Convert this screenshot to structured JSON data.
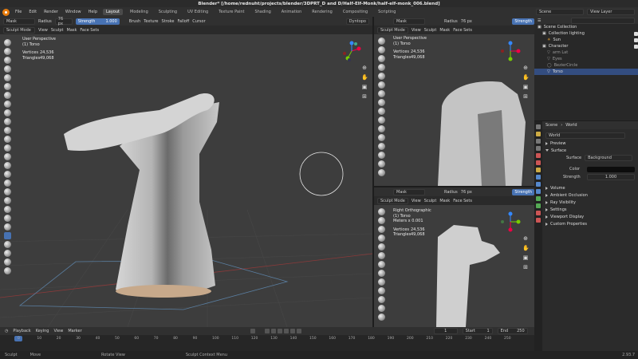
{
  "title": "Blender* [/home/rednuht/projects/blender/3DPRT_D and D/Half-Elf-Monk/half-elf-monk_006.blend]",
  "menu": [
    "File",
    "Edit",
    "Render",
    "Window",
    "Help"
  ],
  "workspaces": [
    "Layout",
    "Modeling",
    "Sculpting",
    "UV Editing",
    "Texture Paint",
    "Shading",
    "Animation",
    "Rendering",
    "Compositing",
    "Scripting"
  ],
  "active_workspace": "Layout",
  "scene_label": "Scene",
  "view_layer_label": "View Layer",
  "tool_header": {
    "brush": "Mask",
    "radius_label": "Radius",
    "radius_value": "76 px",
    "strength_label": "Strength",
    "strength_value": "1.000",
    "menus": [
      "Brush",
      "Texture",
      "Stroke",
      "Falloff",
      "Cursor"
    ],
    "dyntopo": "Dyntopo"
  },
  "mode_header": {
    "mode": "Sculpt Mode",
    "menus": [
      "View",
      "Sculpt",
      "Mask",
      "Face Sets"
    ]
  },
  "viewport_main": {
    "view": "User Perspective",
    "object": "(1) Torso",
    "vertices_label": "Vertices",
    "vertices": "24,536",
    "triangles_label": "Triangles",
    "triangles": "49,068"
  },
  "viewport_tr": {
    "brush": "Mask",
    "radius_label": "Radius",
    "radius_value": "76 px",
    "strength_label": "Strength",
    "view": "User Perspective",
    "object": "(1) Torso",
    "vertices_label": "Vertices",
    "vertices": "24,536",
    "triangles_label": "Triangles",
    "triangles": "49,068"
  },
  "viewport_br": {
    "brush": "Mask",
    "radius_label": "Radius",
    "radius_value": "76 px",
    "strength_label": "Strength",
    "view": "Right Orthographic",
    "object": "(1) Torso",
    "scale": "Meters x 0.001",
    "vertices_label": "Vertices",
    "vertices": "24,536",
    "triangles_label": "Triangles",
    "triangles": "49,068"
  },
  "outliner": {
    "header": "Scene Collection",
    "rows": [
      {
        "label": "Collection lighting",
        "indent": 1
      },
      {
        "label": "Sun",
        "indent": 2
      },
      {
        "label": "Character",
        "indent": 1
      },
      {
        "label": "arm Lat",
        "indent": 2
      },
      {
        "label": "Eyes",
        "indent": 2
      },
      {
        "label": "BezierCircle",
        "indent": 2
      },
      {
        "label": "Torso",
        "indent": 2,
        "selected": true
      }
    ]
  },
  "properties": {
    "breadcrumb_scene": "Scene",
    "breadcrumb_world": "World",
    "world_name": "World",
    "sections": [
      "Preview",
      "Surface"
    ],
    "surface_label": "Surface",
    "surface_value": "Background",
    "color_label": "Color",
    "strength_label": "Strength",
    "strength_value": "1.000",
    "collapsed": [
      "Volume",
      "Ambient Occlusion",
      "Ray Visibility",
      "Settings",
      "Viewport Display",
      "Custom Properties"
    ]
  },
  "timeline": {
    "menus": [
      "Playback",
      "Keying",
      "View",
      "Marker"
    ],
    "current": "1",
    "start_label": "Start",
    "start": "1",
    "end_label": "End",
    "end": "250",
    "ticks": [
      "0",
      "10",
      "20",
      "30",
      "40",
      "50",
      "60",
      "70",
      "80",
      "90",
      "100",
      "110",
      "120",
      "130",
      "140",
      "150",
      "160",
      "170",
      "180",
      "190",
      "200",
      "210",
      "220",
      "230",
      "240",
      "250"
    ]
  },
  "status": {
    "left": "Sculpt",
    "move": "Move",
    "rotate": "Rotate View",
    "context": "Sculpt Context Menu",
    "version": "2.93.7"
  },
  "colors": {
    "accent": "#4772b3",
    "selected_row": "#334d80",
    "viewport_bg": "#3d3d3d"
  }
}
